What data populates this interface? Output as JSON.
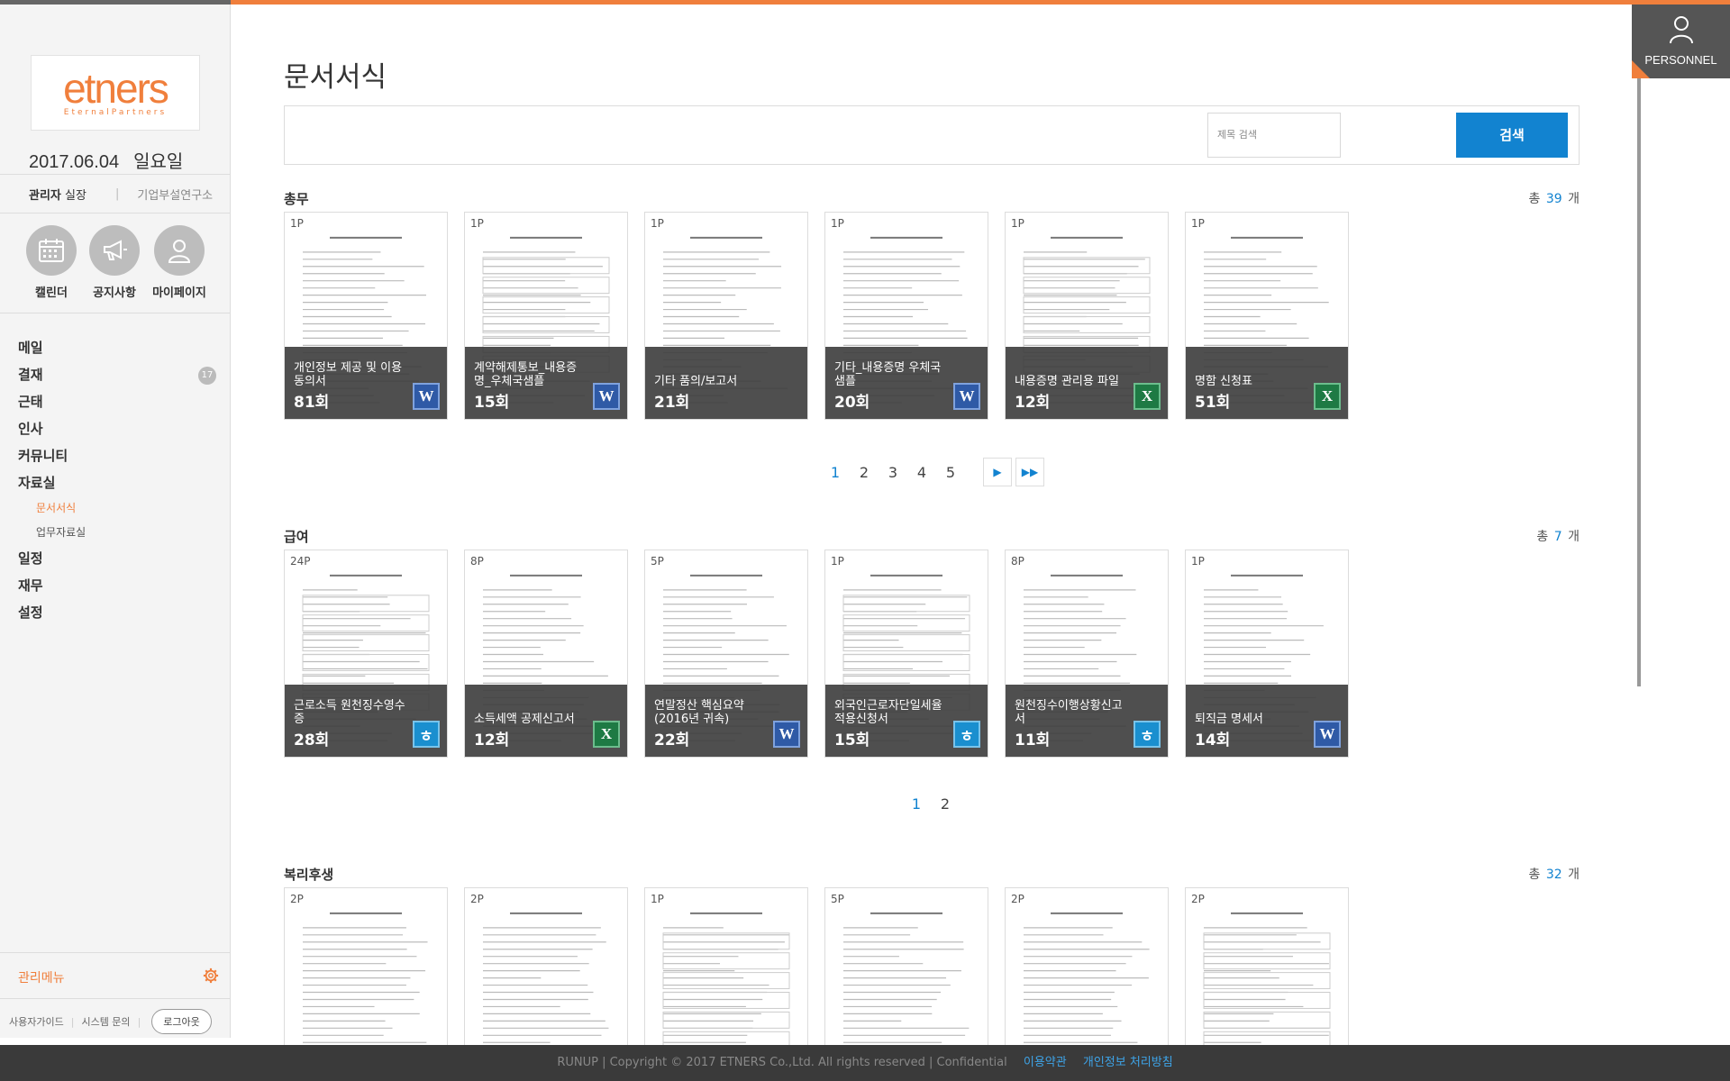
{
  "brand": {
    "logo": "etners",
    "tagline": "EternalPartners"
  },
  "date": {
    "date": "2017.06.04",
    "weekday": "일요일"
  },
  "user": {
    "name": "관리자",
    "title": "실장",
    "dept": "기업부설연구소"
  },
  "quick": [
    {
      "label": "캘린더",
      "icon": "calendar-icon"
    },
    {
      "label": "공지사항",
      "icon": "megaphone-icon"
    },
    {
      "label": "마이페이지",
      "icon": "user-icon"
    }
  ],
  "nav": {
    "mail": "메일",
    "approval": "결재",
    "approval_badge": "17",
    "attendance": "근태",
    "hr": "인사",
    "community": "커뮤니티",
    "library": "자료실",
    "library_sub1": "문서서식",
    "library_sub2": "업무자료실",
    "schedule": "일정",
    "finance": "재무",
    "settings": "설정"
  },
  "admin": {
    "label": "관리메뉴"
  },
  "sidebar_footer": {
    "guide": "사용자가이드",
    "inquiry": "시스템 문의",
    "logout": "로그아웃"
  },
  "right_rail": {
    "label": "PERSONNEL"
  },
  "page": {
    "title": "문서서식"
  },
  "search": {
    "placeholder": "제목 검색",
    "button": "검색"
  },
  "sections": [
    {
      "title": "총무",
      "count_prefix": "총",
      "count": "39",
      "count_suffix": "개",
      "cards": [
        {
          "page": "1P",
          "title": "개인정보 제공 및 이용 동의서",
          "count": "81회",
          "file": "W"
        },
        {
          "page": "1P",
          "title": "계약해제통보_내용증명_우체국샘플",
          "count": "15회",
          "file": "W"
        },
        {
          "page": "1P",
          "title": "기타 품의/보고서",
          "count": "21회",
          "file": ""
        },
        {
          "page": "1P",
          "title": "기타_내용증명 우체국샘플",
          "count": "20회",
          "file": "W"
        },
        {
          "page": "1P",
          "title": "내용증명 관리용 파일",
          "count": "12회",
          "file": "X"
        },
        {
          "page": "1P",
          "title": "명함 신청표",
          "count": "51회",
          "file": "X"
        }
      ],
      "pages": [
        "1",
        "2",
        "3",
        "4",
        "5"
      ]
    },
    {
      "title": "급여",
      "count_prefix": "총",
      "count": "7",
      "count_suffix": "개",
      "cards": [
        {
          "page": "24P",
          "title": "근로소득 원천징수영수증",
          "count": "28회",
          "file": "ㅎ"
        },
        {
          "page": "8P",
          "title": "소득세액 공제신고서",
          "count": "12회",
          "file": "X"
        },
        {
          "page": "5P",
          "title": "연말정산 핵심요약 (2016년 귀속)",
          "count": "22회",
          "file": "W"
        },
        {
          "page": "1P",
          "title": "외국인근로자단일세율 적용신청서",
          "count": "15회",
          "file": "ㅎ"
        },
        {
          "page": "8P",
          "title": "원천징수이행상황신고서",
          "count": "11회",
          "file": "ㅎ"
        },
        {
          "page": "1P",
          "title": "퇴직금 명세서",
          "count": "14회",
          "file": "W"
        }
      ],
      "pages": [
        "1",
        "2"
      ]
    },
    {
      "title": "복리후생",
      "count_prefix": "총",
      "count": "32",
      "count_suffix": "개",
      "cards": [
        {
          "page": "2P"
        },
        {
          "page": "2P"
        },
        {
          "page": "1P"
        },
        {
          "page": "5P"
        },
        {
          "page": "2P"
        },
        {
          "page": "2P"
        }
      ]
    }
  ],
  "footer": {
    "copyright": "RUNUP | Copyright © 2017 ETNERS Co.,Ltd. All rights reserved | Confidential",
    "terms": "이용약관",
    "privacy": "개인정보 처리방침"
  },
  "colors": {
    "accent": "#f07f3c",
    "primary": "#1283d0",
    "word": "#2f5aa6",
    "excel": "#1e7a44",
    "hwp": "#1a8fcf"
  }
}
